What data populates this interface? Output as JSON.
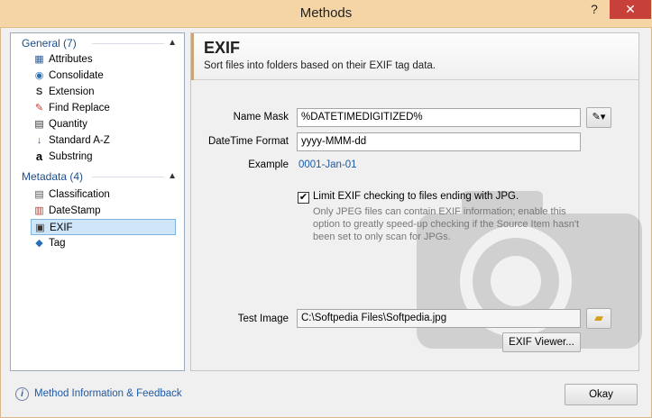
{
  "window": {
    "title": "Methods",
    "help_label": "?",
    "close_label": "✕"
  },
  "sidebar": {
    "groups": [
      {
        "label": "General (7)",
        "caret": "▲"
      },
      {
        "label": "Metadata (4)",
        "caret": "▲"
      }
    ],
    "general_items": [
      {
        "label": "Attributes",
        "icon": "▦"
      },
      {
        "label": "Consolidate",
        "icon": "◉"
      },
      {
        "label": "Extension",
        "icon": "S"
      },
      {
        "label": "Find Replace",
        "icon": "✎"
      },
      {
        "label": "Quantity",
        "icon": "▤"
      },
      {
        "label": "Standard A-Z",
        "icon": "↓"
      },
      {
        "label": "Substring",
        "icon": "a"
      }
    ],
    "metadata_items": [
      {
        "label": "Classification",
        "icon": "▤"
      },
      {
        "label": "DateStamp",
        "icon": "▥"
      },
      {
        "label": "EXIF",
        "icon": "▣"
      },
      {
        "label": "Tag",
        "icon": "◆"
      }
    ]
  },
  "panel": {
    "title": "EXIF",
    "description": "Sort files into folders based on their EXIF tag data.",
    "name_mask_label": "Name Mask",
    "name_mask_value": "%DATETIMEDIGITIZED%",
    "datetime_format_label": "DateTime Format",
    "datetime_format_value": "yyyy-MMM-dd",
    "example_label": "Example",
    "example_value": "0001-Jan-01",
    "limit_checkbox_label": "Limit EXIF checking to files ending with JPG.",
    "limit_checked_glyph": "✔",
    "limit_note": "Only JPEG files can contain EXIF information; enable this option to greatly speed-up checking if the Source Item hasn't been set to only scan for JPGs.",
    "test_image_label": "Test Image",
    "test_image_value": "C:\\Softpedia Files\\Softpedia.jpg",
    "exif_viewer_label": "EXIF Viewer..."
  },
  "footer": {
    "info_link": "Method Information & Feedback",
    "ok_label": "Okay"
  }
}
